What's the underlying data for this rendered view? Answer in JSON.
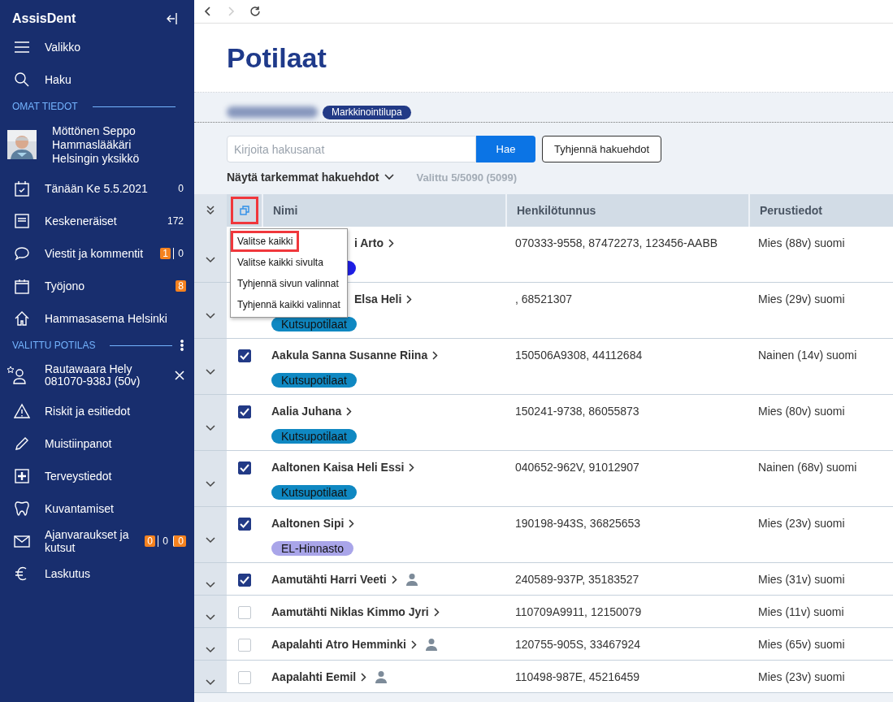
{
  "app": {
    "title": "AssisDent"
  },
  "sidebar": [
    {
      "kind": "item",
      "label": "Valikko"
    },
    {
      "kind": "item",
      "label": "Haku"
    },
    {
      "kind": "header",
      "label": "OMAT TIEDOT"
    },
    {
      "kind": "profile",
      "lines": [
        "Möttönen Seppo",
        "Hammaslääkäri",
        "Helsingin yksikkö"
      ]
    },
    {
      "kind": "item",
      "label": "Tänään Ke 5.5.2021",
      "counts": [
        {
          "text": "0",
          "highlight": false
        }
      ]
    },
    {
      "kind": "item",
      "label": "Keskeneräiset",
      "counts": [
        {
          "text": "172",
          "highlight": false
        }
      ]
    },
    {
      "kind": "item",
      "label": "Viestit ja kommentit",
      "counts": [
        {
          "text": "1",
          "highlight": true
        },
        {
          "text": "0",
          "highlight": false
        }
      ]
    },
    {
      "kind": "item",
      "label": "Työjono",
      "counts": [
        {
          "text": "8",
          "highlight": true
        }
      ]
    },
    {
      "kind": "item",
      "label": "Hammasasema Helsinki"
    },
    {
      "kind": "header",
      "label": "VALITTU POTILAS"
    },
    {
      "kind": "patient",
      "lines": [
        "Rautawaara Hely",
        "081070-938J (50v)"
      ]
    },
    {
      "kind": "item",
      "label": "Riskit ja esitiedot"
    },
    {
      "kind": "item",
      "label": "Muistiinpanot"
    },
    {
      "kind": "item",
      "label": "Terveystiedot"
    },
    {
      "kind": "item",
      "label": "Kuvantamiset"
    },
    {
      "kind": "item",
      "label": "Ajanvaraukset ja kutsut",
      "counts": [
        {
          "text": "0",
          "highlight": true
        },
        {
          "text": "0",
          "highlight": false
        },
        {
          "text": "0",
          "highlight": true
        }
      ]
    },
    {
      "kind": "item",
      "label": "Laskutus"
    }
  ],
  "page": {
    "title": "Potilaat",
    "tag": "Markkinointilupa"
  },
  "search": {
    "placeholder": "Kirjoita hakusanat",
    "button": "Hae",
    "clear_button": "Tyhjennä hakuehdot",
    "more_filters": "Näytä tarkemmat hakuehdot",
    "selection_count": "Valittu 5/5090 (5099)"
  },
  "table": {
    "columns": [
      "Nimi",
      "Henkilötunnus",
      "Perustiedot"
    ],
    "select_menu_highlighted": true,
    "rows": [
      {
        "name": "i Arto",
        "covered": true,
        "ids": "070333-9558, 87472273, 123456-AABB",
        "info": "Mies (88v) suomi",
        "person_marker": false,
        "tags": [
          {
            "color": "#1f1fe6"
          }
        ]
      },
      {
        "name": "Elsa Heli",
        "covered": true,
        "ids": ", 68521307",
        "info": "Mies (29v) suomi",
        "person_marker": false,
        "tags": [
          {
            "label": "Kutsupotilaat",
            "color": "#0f88c2"
          }
        ]
      },
      {
        "name": "Aakula Sanna Susanne Riina",
        "checked": true,
        "ids": "150506A9308, 44112684",
        "info": "Nainen (14v) suomi",
        "person_marker": false,
        "tags": [
          {
            "label": "Kutsupotilaat",
            "color": "#0f88c2"
          }
        ]
      },
      {
        "name": "Aalia Juhana",
        "checked": true,
        "ids": "150241-9738, 86055873",
        "info": "Mies (80v) suomi",
        "person_marker": false,
        "tags": [
          {
            "label": "Kutsupotilaat",
            "color": "#0f88c2"
          }
        ]
      },
      {
        "name": "Aaltonen Kaisa Heli Essi",
        "checked": true,
        "ids": "040652-962V, 91012907",
        "info": "Nainen (68v) suomi",
        "person_marker": false,
        "tags": [
          {
            "label": "Kutsupotilaat",
            "color": "#0f88c2"
          }
        ]
      },
      {
        "name": "Aaltonen Sipi",
        "checked": true,
        "ids": "190198-943S, 36825653",
        "info": "Mies (23v) suomi",
        "person_marker": false,
        "tags": [
          {
            "label": "EL-Hinnasto",
            "color": "#a9a5e9"
          }
        ]
      },
      {
        "name": "Aamutähti Harri Veeti",
        "checked": true,
        "ids": "240589-937P, 35183527",
        "info": "Mies (31v) suomi",
        "person_marker": true
      },
      {
        "name": "Aamutähti Niklas Kimmo Jyri",
        "checked": false,
        "ids": "110709A9911, 12150079",
        "info": "Mies (11v) suomi",
        "person_marker": false
      },
      {
        "name": "Aapalahti Atro Hemminki",
        "checked": false,
        "ids": "120755-905S, 33467924",
        "info": "Mies (65v) suomi",
        "person_marker": true
      },
      {
        "name": "Aapalahti Eemil",
        "checked": false,
        "ids": "110498-987E, 45216459",
        "info": "Mies (23v) suomi",
        "person_marker": true
      }
    ]
  },
  "menu": {
    "items": [
      {
        "label": "Valitse kaikki",
        "highlighted": true
      },
      {
        "label": "Valitse kaikki sivulta",
        "highlighted": false
      },
      {
        "label": "Tyhjennä sivun valinnat",
        "highlighted": false
      },
      {
        "label": "Tyhjennä kaikki valinnat",
        "highlighted": false
      }
    ]
  }
}
